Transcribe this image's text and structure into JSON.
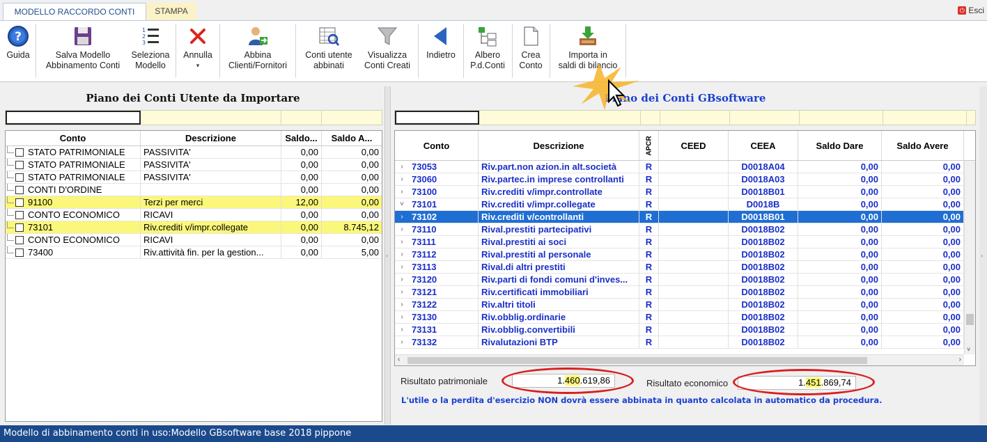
{
  "tabs": [
    {
      "label": "MODELLO RACCORDO CONTI",
      "active": true
    },
    {
      "label": "STAMPA",
      "active": false
    }
  ],
  "exit_label": "Esci",
  "ribbon": [
    {
      "id": "guida",
      "line1": "Guida",
      "line2": "",
      "icon": "help-icon"
    },
    {
      "id": "salva",
      "line1": "Salva Modello",
      "line2": "Abbinamento Conti",
      "icon": "floppy-disk-icon"
    },
    {
      "id": "seleziona",
      "line1": "Seleziona",
      "line2": "Modello",
      "icon": "numbered-list-icon"
    },
    {
      "id": "annulla",
      "line1": "Annulla",
      "line2": "",
      "icon": "red-x-icon"
    },
    {
      "id": "abbina",
      "line1": "Abbina",
      "line2": "Clienti/Fornitori",
      "icon": "user-link-icon"
    },
    {
      "id": "conti-utente",
      "line1": "Conti utente",
      "line2": "abbinati",
      "icon": "table-search-icon"
    },
    {
      "id": "visualizza",
      "line1": "Visualizza",
      "line2": "Conti Creati",
      "icon": "funnel-icon"
    },
    {
      "id": "indietro",
      "line1": "Indietro",
      "line2": "",
      "icon": "back-arrow-icon"
    },
    {
      "id": "albero",
      "line1": "Albero",
      "line2": "P.d.Conti",
      "icon": "tree-icon"
    },
    {
      "id": "crea",
      "line1": "Crea",
      "line2": "Conto",
      "icon": "new-document-icon"
    },
    {
      "id": "importa",
      "line1": "Importa in",
      "line2": "saldi di bilancio",
      "icon": "import-tray-icon"
    }
  ],
  "left": {
    "title": "Piano dei Conti Utente da Importare",
    "columns": [
      "Conto",
      "Descrizione",
      "Saldo...",
      "Saldo A..."
    ],
    "rows": [
      {
        "conto": "STATO PATRIMONIALE",
        "descr": "PASSIVITA'",
        "dare": "0,00",
        "avere": "0,00",
        "hl": false
      },
      {
        "conto": "STATO PATRIMONIALE",
        "descr": "PASSIVITA'",
        "dare": "0,00",
        "avere": "0,00",
        "hl": false
      },
      {
        "conto": "STATO PATRIMONIALE",
        "descr": "PASSIVITA'",
        "dare": "0,00",
        "avere": "0,00",
        "hl": false
      },
      {
        "conto": "CONTI D'ORDINE",
        "descr": "",
        "dare": "0,00",
        "avere": "0,00",
        "hl": false
      },
      {
        "conto": "91100",
        "descr": "Terzi per merci",
        "dare": "12,00",
        "avere": "0,00",
        "hl": true
      },
      {
        "conto": "CONTO ECONOMICO",
        "descr": "RICAVI",
        "dare": "0,00",
        "avere": "0,00",
        "hl": false
      },
      {
        "conto": "73101",
        "descr": "Riv.crediti v/impr.collegate",
        "dare": "0,00",
        "avere": "8.745,12",
        "hl": true
      },
      {
        "conto": "CONTO ECONOMICO",
        "descr": "RICAVI",
        "dare": "0,00",
        "avere": "0,00",
        "hl": false
      },
      {
        "conto": "73400",
        "descr": "Riv.attività fin. per la gestion...",
        "dare": "0,00",
        "avere": "5,00",
        "hl": false
      }
    ]
  },
  "right": {
    "title": "Piano dei Conti GBsoftware",
    "columns": [
      "Conto",
      "Descrizione",
      "APCR",
      "CEED",
      "CEEA",
      "Saldo Dare",
      "Saldo Avere"
    ],
    "rows": [
      {
        "conto": "73053",
        "descr": "Riv.part.non azion.in alt.società",
        "apcr": "R",
        "ceed": "",
        "ceea": "D0018A04",
        "dare": "0,00",
        "avere": "0,00",
        "exp": "›"
      },
      {
        "conto": "73060",
        "descr": "Riv.partec.in imprese controllanti",
        "apcr": "R",
        "ceed": "",
        "ceea": "D0018A03",
        "dare": "0,00",
        "avere": "0,00",
        "exp": "›"
      },
      {
        "conto": "73100",
        "descr": "Riv.crediti v/impr.controllate",
        "apcr": "R",
        "ceed": "",
        "ceea": "D0018B01",
        "dare": "0,00",
        "avere": "0,00",
        "exp": "›"
      },
      {
        "conto": "73101",
        "descr": "Riv.crediti v/impr.collegate",
        "apcr": "R",
        "ceed": "",
        "ceea": "D0018B",
        "dare": "0,00",
        "avere": "0,00",
        "exp": "˅"
      },
      {
        "conto": "73102",
        "descr": "Riv.crediti v/controllanti",
        "apcr": "R",
        "ceed": "",
        "ceea": "D0018B01",
        "dare": "0,00",
        "avere": "0,00",
        "exp": "›",
        "sel": true
      },
      {
        "conto": "73110",
        "descr": "Rival.prestiti partecipativi",
        "apcr": "R",
        "ceed": "",
        "ceea": "D0018B02",
        "dare": "0,00",
        "avere": "0,00",
        "exp": "›"
      },
      {
        "conto": "73111",
        "descr": "Rival.prestiti ai soci",
        "apcr": "R",
        "ceed": "",
        "ceea": "D0018B02",
        "dare": "0,00",
        "avere": "0,00",
        "exp": "›"
      },
      {
        "conto": "73112",
        "descr": "Rival.prestiti al personale",
        "apcr": "R",
        "ceed": "",
        "ceea": "D0018B02",
        "dare": "0,00",
        "avere": "0,00",
        "exp": "›"
      },
      {
        "conto": "73113",
        "descr": "Rival.di altri prestiti",
        "apcr": "R",
        "ceed": "",
        "ceea": "D0018B02",
        "dare": "0,00",
        "avere": "0,00",
        "exp": "›"
      },
      {
        "conto": "73120",
        "descr": "Riv.parti di fondi comuni d'inves...",
        "apcr": "R",
        "ceed": "",
        "ceea": "D0018B02",
        "dare": "0,00",
        "avere": "0,00",
        "exp": "›"
      },
      {
        "conto": "73121",
        "descr": "Riv.certificati immobiliari",
        "apcr": "R",
        "ceed": "",
        "ceea": "D0018B02",
        "dare": "0,00",
        "avere": "0,00",
        "exp": "›"
      },
      {
        "conto": "73122",
        "descr": "Riv.altri titoli",
        "apcr": "R",
        "ceed": "",
        "ceea": "D0018B02",
        "dare": "0,00",
        "avere": "0,00",
        "exp": "›"
      },
      {
        "conto": "73130",
        "descr": "Riv.obblig.ordinarie",
        "apcr": "R",
        "ceed": "",
        "ceea": "D0018B02",
        "dare": "0,00",
        "avere": "0,00",
        "exp": "›"
      },
      {
        "conto": "73131",
        "descr": "Riv.obblig.convertibili",
        "apcr": "R",
        "ceed": "",
        "ceea": "D0018B02",
        "dare": "0,00",
        "avere": "0,00",
        "exp": "›"
      },
      {
        "conto": "73132",
        "descr": "Rivalutazioni BTP",
        "apcr": "R",
        "ceed": "",
        "ceea": "D0018B02",
        "dare": "0,00",
        "avere": "0,00",
        "exp": "›"
      }
    ]
  },
  "results": {
    "patrimoniale_label": "Risultato patrimoniale",
    "patrimoniale_pre": "1.",
    "patrimoniale_hl": "460",
    "patrimoniale_post": ".619,86",
    "economico_label": "Risultato economico",
    "economico_pre": "1.",
    "economico_hl": "451",
    "economico_post": ".869,74",
    "note": "L'utile o la perdita d'esercizio NON dovrà essere abbinata in quanto calcolata in automatico da procedura."
  },
  "status": "Modello di abbinamento conti in uso:Modello GBsoftware base 2018 pippone",
  "colors": {
    "accent_blue": "#1a3fd0",
    "selection": "#1f6ed4",
    "highlight": "#fbf77a",
    "status_bar": "#1b4a8c",
    "oval": "#d81f1f"
  }
}
